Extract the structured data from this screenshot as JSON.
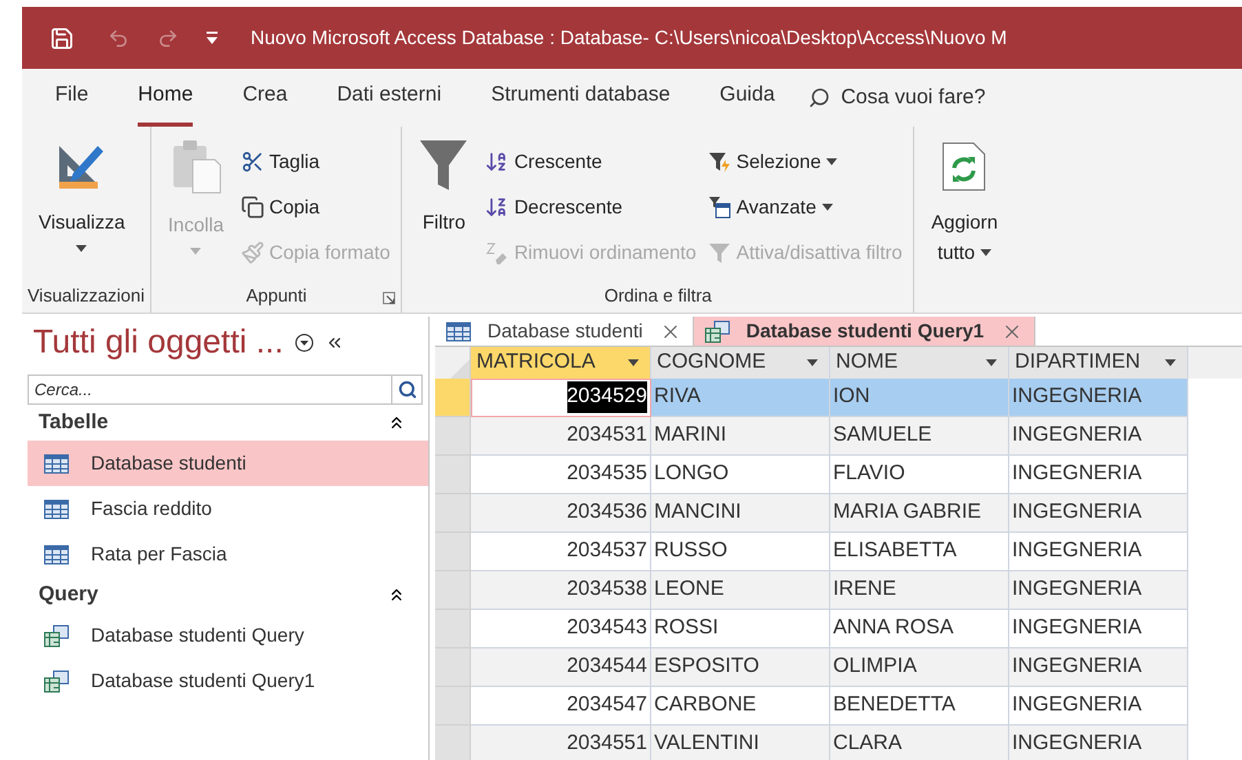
{
  "title_bar": {
    "title": "Nuovo Microsoft Access Database : Database- C:\\Users\\nicoa\\Desktop\\Access\\Nuovo M"
  },
  "menu_tabs": [
    {
      "label": "File",
      "selected": false
    },
    {
      "label": "Home",
      "selected": true
    },
    {
      "label": "Crea",
      "selected": false
    },
    {
      "label": "Dati esterni",
      "selected": false
    },
    {
      "label": "Strumenti database",
      "selected": false
    },
    {
      "label": "Guida",
      "selected": false
    }
  ],
  "tell_me": {
    "placeholder": "Cosa vuoi fare?"
  },
  "ribbon": {
    "groups": [
      {
        "label": "Visualizzazioni",
        "launcher": false,
        "columns": [
          [
            {
              "label": "Visualizza",
              "kind": "large",
              "disabled": false,
              "dropdown": true
            }
          ]
        ]
      },
      {
        "label": "Appunti",
        "launcher": true,
        "columns": [
          [
            {
              "label": "Incolla",
              "kind": "large",
              "disabled": true,
              "dropdown": true
            }
          ],
          [
            {
              "label": "Taglia",
              "kind": "small",
              "disabled": false,
              "dropdown": false
            },
            {
              "label": "Copia",
              "kind": "small",
              "disabled": false,
              "dropdown": false
            },
            {
              "label": "Copia formato",
              "kind": "small",
              "disabled": true,
              "dropdown": false
            }
          ]
        ]
      },
      {
        "label": "Ordina e filtra",
        "launcher": false,
        "columns": [
          [
            {
              "label": "Filtro",
              "kind": "large",
              "disabled": false,
              "dropdown": false
            }
          ],
          [
            {
              "label": "Crescente",
              "kind": "small",
              "disabled": false,
              "dropdown": false
            },
            {
              "label": "Decrescente",
              "kind": "small",
              "disabled": false,
              "dropdown": false
            },
            {
              "label": "Rimuovi ordinamento",
              "kind": "small",
              "disabled": true,
              "dropdown": false
            }
          ],
          [
            {
              "label": "Selezione",
              "kind": "small",
              "disabled": false,
              "dropdown": true
            },
            {
              "label": "Avanzate",
              "kind": "small",
              "disabled": false,
              "dropdown": true
            },
            {
              "label": "Attiva/disattiva filtro",
              "kind": "small",
              "disabled": true,
              "dropdown": false
            }
          ]
        ]
      },
      {
        "columns": [
          [
            {
              "label": "Aggiorn",
              "label_2": "tutto",
              "kind": "large",
              "disabled": false,
              "dropdown": true
            }
          ]
        ]
      }
    ]
  },
  "nav_pane": {
    "title": "Tutti gli oggetti ...",
    "search": {
      "placeholder": "Cerca..."
    },
    "sections": [
      {
        "label": "Tabelle",
        "expanded": true,
        "items": [
          {
            "label": "Database studenti",
            "kind": "table",
            "selected": true
          },
          {
            "label": "Fascia reddito",
            "kind": "table",
            "selected": false
          },
          {
            "label": "Rata per Fascia",
            "kind": "table",
            "selected": false
          }
        ]
      },
      {
        "label": "Query",
        "expanded": true,
        "items": [
          {
            "label": "Database studenti Query",
            "kind": "query",
            "selected": false
          },
          {
            "label": "Database studenti Query1",
            "kind": "query",
            "selected": false
          }
        ]
      }
    ]
  },
  "document_tabs": [
    {
      "label": "Database studenti",
      "kind": "table",
      "selected": false
    },
    {
      "label": "Database studenti Query1",
      "kind": "query",
      "selected": true
    }
  ],
  "datasheet": {
    "columns": [
      {
        "label": "MATRICOLA",
        "selected": true
      },
      {
        "label": "COGNOME",
        "selected": false
      },
      {
        "label": "NOME",
        "selected": false
      },
      {
        "label": "DIPARTIMEN",
        "selected": false
      }
    ],
    "rows": [
      {
        "cells": [
          "2034529",
          "RIVA",
          "ION",
          "INGEGNERIA"
        ],
        "selected": true
      },
      {
        "cells": [
          "2034531",
          "MARINI",
          "SAMUELE",
          "INGEGNERIA"
        ],
        "selected": false
      },
      {
        "cells": [
          "2034535",
          "LONGO",
          "FLAVIO",
          "INGEGNERIA"
        ],
        "selected": false
      },
      {
        "cells": [
          "2034536",
          "MANCINI",
          "MARIA GABRIE",
          "INGEGNERIA"
        ],
        "selected": false
      },
      {
        "cells": [
          "2034537",
          "RUSSO",
          "ELISABETTA",
          "INGEGNERIA"
        ],
        "selected": false
      },
      {
        "cells": [
          "2034538",
          "LEONE",
          "IRENE",
          "INGEGNERIA"
        ],
        "selected": false
      },
      {
        "cells": [
          "2034543",
          "ROSSI",
          "ANNA ROSA",
          "INGEGNERIA"
        ],
        "selected": false
      },
      {
        "cells": [
          "2034544",
          "ESPOSITO",
          "OLIMPIA",
          "INGEGNERIA"
        ],
        "selected": false
      },
      {
        "cells": [
          "2034547",
          "CARBONE",
          "BENEDETTA",
          "INGEGNERIA"
        ],
        "selected": false
      },
      {
        "cells": [
          "2034551",
          "VALENTINI",
          "CLARA",
          "INGEGNERIA"
        ],
        "selected": false
      }
    ]
  }
}
